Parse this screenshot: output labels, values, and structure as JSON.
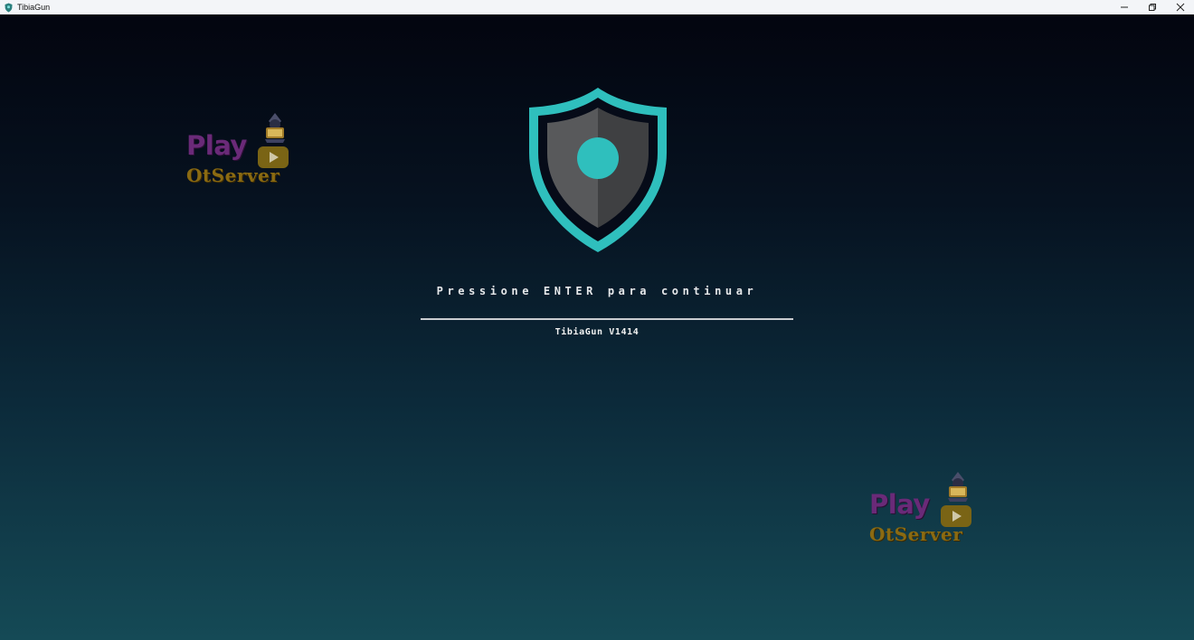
{
  "window": {
    "title": "TibiaGun",
    "controls": [
      "minimize-icon",
      "restore-icon",
      "close-icon"
    ]
  },
  "main": {
    "prompt": "Pressione ENTER para continuar",
    "version": "TibiaGun V1414"
  },
  "watermark": {
    "line1": "Play",
    "line2": "OtServer"
  },
  "colors": {
    "shield_outer": "#2fbfbd",
    "shield_inner_left": "#5a5c5e",
    "shield_inner_right": "#3e4042",
    "shield_dot": "#2fbfbd",
    "background_top": "#03050f",
    "background_bottom": "#154a56"
  }
}
